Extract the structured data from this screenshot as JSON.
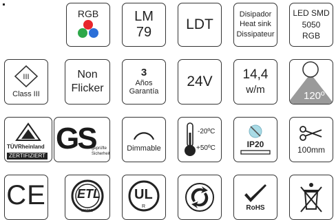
{
  "rgb": {
    "label": "RGB"
  },
  "lm79": {
    "line1": "LM",
    "line2": "79"
  },
  "ldt": {
    "label": "LDT"
  },
  "heatsink": {
    "line1": "Disipador",
    "line2": "Heat sink",
    "line3": "Dissipateur"
  },
  "ledsmd": {
    "line1": "LED SMD",
    "line2": "5050",
    "line3": "RGB"
  },
  "class3": {
    "symbol": "III",
    "label": "Class III"
  },
  "nonflicker": {
    "line1": "Non",
    "line2": "Flicker"
  },
  "warranty": {
    "number": "3",
    "line2": "Años",
    "line3": "Garantía"
  },
  "voltage": {
    "label": "24V"
  },
  "power": {
    "line1": "14,4",
    "line2": "w/m"
  },
  "angle": {
    "label": "120º"
  },
  "tuv": {
    "name": "TÜVRheinland",
    "cert": "ZERTIFIZIERT"
  },
  "gs": {
    "mark": "GS",
    "line1": "geprüfte",
    "line2": "Sicherheit"
  },
  "dimmable": {
    "label": "Dimmable"
  },
  "temperature": {
    "max": "-20ºC",
    "min": "+50ºC"
  },
  "ip": {
    "label": "IP20"
  },
  "cut": {
    "label": "100mm"
  },
  "ce": {
    "label": "CE"
  },
  "etl": {
    "label": "ETL",
    "sub": "LISTED"
  },
  "ul": {
    "label": "UL",
    "mark": "R"
  },
  "rohs": {
    "label": "RoHS"
  },
  "colors": {
    "red": "#e8262c",
    "green": "#2ea84a",
    "blue": "#2b6fd8",
    "stroke": "#333333",
    "grey": "#9a9a9a"
  },
  "icons": [
    "rgb-dots-icon",
    "class-iii-diamond-icon",
    "light-cone-icon",
    "dimmer-arc-icon",
    "thermometer-icon",
    "ip-drop-icon",
    "scissors-icon",
    "ce-mark-icon",
    "etl-mark-icon",
    "ul-mark-icon",
    "recycle-icon",
    "rohs-check-icon",
    "weee-bin-icon"
  ]
}
